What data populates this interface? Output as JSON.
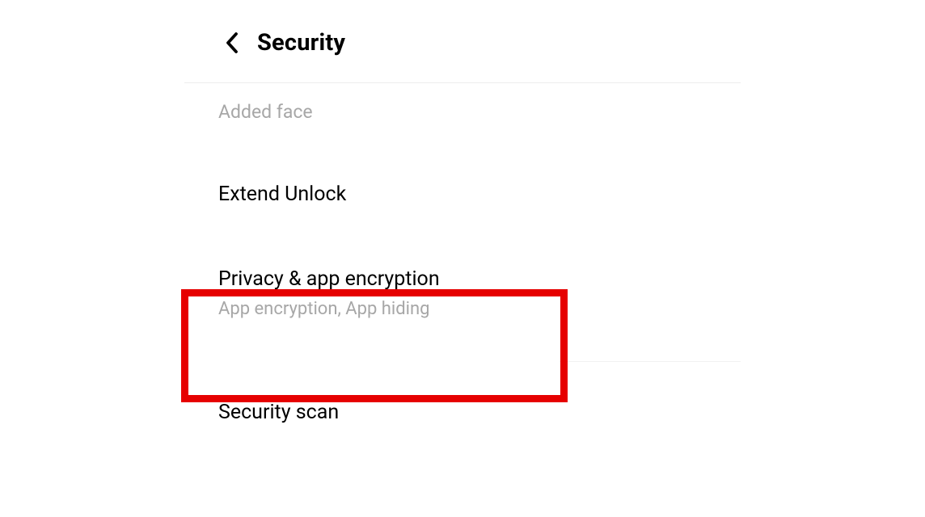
{
  "header": {
    "title": "Security"
  },
  "section": {
    "label": "Added face"
  },
  "items": {
    "extend_unlock": {
      "title": "Extend Unlock"
    },
    "privacy_encryption": {
      "title": "Privacy & app encryption",
      "subtitle": "App encryption, App hiding"
    },
    "security_scan": {
      "title": "Security scan"
    }
  }
}
